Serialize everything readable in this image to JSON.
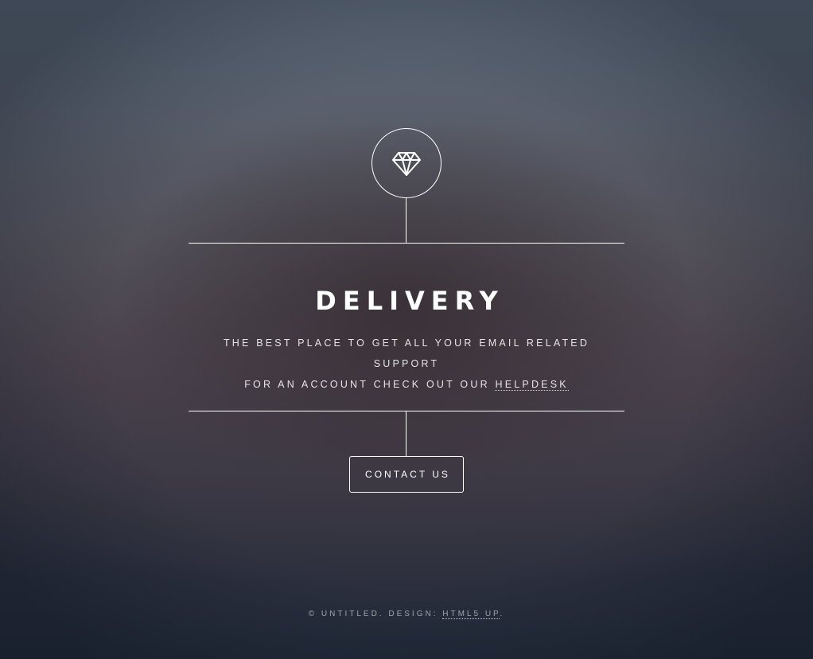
{
  "header": {
    "logo_icon": "diamond-icon",
    "title": "DELIVERY",
    "description_line1": "THE BEST PLACE TO GET ALL YOUR EMAIL RELATED SUPPORT",
    "description_line2_prefix": "FOR AN ACCOUNT CHECK OUT OUR ",
    "helpdesk_link": "HELPDESK"
  },
  "actions": {
    "contact_label": "CONTACT US"
  },
  "footer": {
    "copyright_prefix": "© UNTITLED. DESIGN: ",
    "design_link": "HTML5 UP",
    "suffix": "."
  },
  "colors": {
    "foreground": "#ffffff",
    "background_top": "#5a6676",
    "background_bottom": "#222b3a"
  }
}
